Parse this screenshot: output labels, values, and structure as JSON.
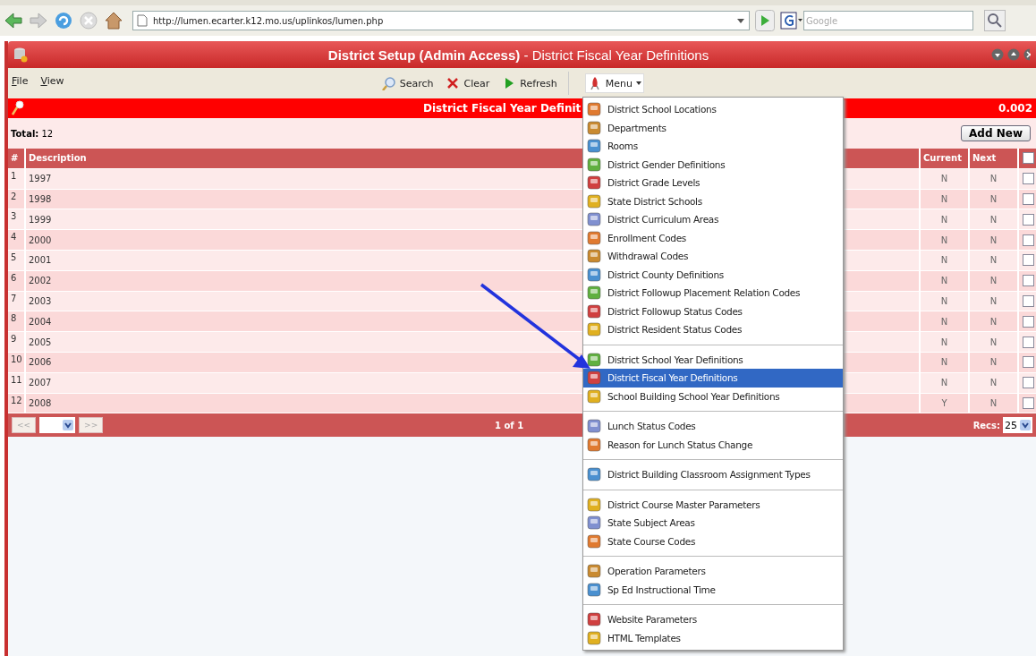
{
  "browser": {
    "url": "http://lumen.ecarter.k12.mo.us/uplinkos/lumen.php",
    "search_placeholder": "Google"
  },
  "window": {
    "title": "**District Setup (Admin Access)** - District Fiscal Year Definitions"
  },
  "menubar": [
    {
      "label": "File"
    },
    {
      "label": "View"
    }
  ],
  "toolbar": [
    {
      "kind": "search",
      "label": "Search"
    },
    {
      "kind": "clear",
      "label": "Clear"
    },
    {
      "kind": "refresh",
      "label": "Refresh"
    },
    {
      "kind": "menu",
      "label": "Menu"
    }
  ],
  "header": {
    "title": "District Fiscal Year Definit",
    "timing": "0.002"
  },
  "total": "**Total:** 12",
  "add_button": "Add New",
  "table": {
    "columns": [
      "#",
      "Description",
      "Current",
      "Next"
    ],
    "select_all": false,
    "rows": [
      {
        "num": "1",
        "description": "1997",
        "current": "N",
        "next": "N",
        "checked": false
      },
      {
        "num": "2",
        "description": "1998",
        "current": "N",
        "next": "N",
        "checked": false
      },
      {
        "num": "3",
        "description": "1999",
        "current": "N",
        "next": "N",
        "checked": false
      },
      {
        "num": "4",
        "description": "2000",
        "current": "N",
        "next": "N",
        "checked": false
      },
      {
        "num": "5",
        "description": "2001",
        "current": "N",
        "next": "N",
        "checked": false
      },
      {
        "num": "6",
        "description": "2002",
        "current": "N",
        "next": "N",
        "checked": false
      },
      {
        "num": "7",
        "description": "2003",
        "current": "N",
        "next": "N",
        "checked": false
      },
      {
        "num": "8",
        "description": "2004",
        "current": "N",
        "next": "N",
        "checked": false
      },
      {
        "num": "9",
        "description": "2005",
        "current": "N",
        "next": "N",
        "checked": false
      },
      {
        "num": "10",
        "description": "2006",
        "current": "N",
        "next": "N",
        "checked": false
      },
      {
        "num": "11",
        "description": "2007",
        "current": "N",
        "next": "N",
        "checked": false
      },
      {
        "num": "12",
        "description": "2008",
        "current": "Y",
        "next": "N",
        "checked": false
      }
    ]
  },
  "pager": {
    "prev": "<<",
    "next": ">>",
    "page": "1 of 1",
    "recs_label": "Recs:",
    "recs": "25"
  },
  "dropdown": [
    [
      {
        "label": "District School Locations",
        "selected": false
      },
      {
        "label": "Departments",
        "selected": false
      },
      {
        "label": "Rooms",
        "selected": false
      },
      {
        "label": "District Gender Definitions",
        "selected": false
      },
      {
        "label": "District Grade Levels",
        "selected": false
      },
      {
        "label": "State District Schools",
        "selected": false
      },
      {
        "label": "District Curriculum Areas",
        "selected": false
      },
      {
        "label": "Enrollment Codes",
        "selected": false
      },
      {
        "label": "Withdrawal Codes",
        "selected": false
      },
      {
        "label": "District County Definitions",
        "selected": false
      },
      {
        "label": "District Followup Placement Relation Codes",
        "selected": false
      },
      {
        "label": "District Followup Status Codes",
        "selected": false
      },
      {
        "label": "District Resident Status Codes",
        "selected": false
      }
    ],
    [
      {
        "label": "District School Year Definitions",
        "selected": false
      },
      {
        "label": "District Fiscal Year Definitions",
        "selected": true
      },
      {
        "label": "School Building School Year Definitions",
        "selected": false
      }
    ],
    [
      {
        "label": "Lunch Status Codes",
        "selected": false
      },
      {
        "label": "Reason for Lunch Status Change",
        "selected": false
      }
    ],
    [
      {
        "label": "District Building Classroom Assignment Types",
        "selected": false
      }
    ],
    [
      {
        "label": "District Course Master Parameters",
        "selected": false
      },
      {
        "label": "State Subject Areas",
        "selected": false
      },
      {
        "label": "State Course Codes",
        "selected": false
      }
    ],
    [
      {
        "label": "Operation Parameters",
        "selected": false
      },
      {
        "label": "Sp Ed Instructional Time",
        "selected": false
      }
    ],
    [
      {
        "label": "Website Parameters",
        "selected": false
      },
      {
        "label": "HTML Templates",
        "selected": false
      }
    ]
  ]
}
